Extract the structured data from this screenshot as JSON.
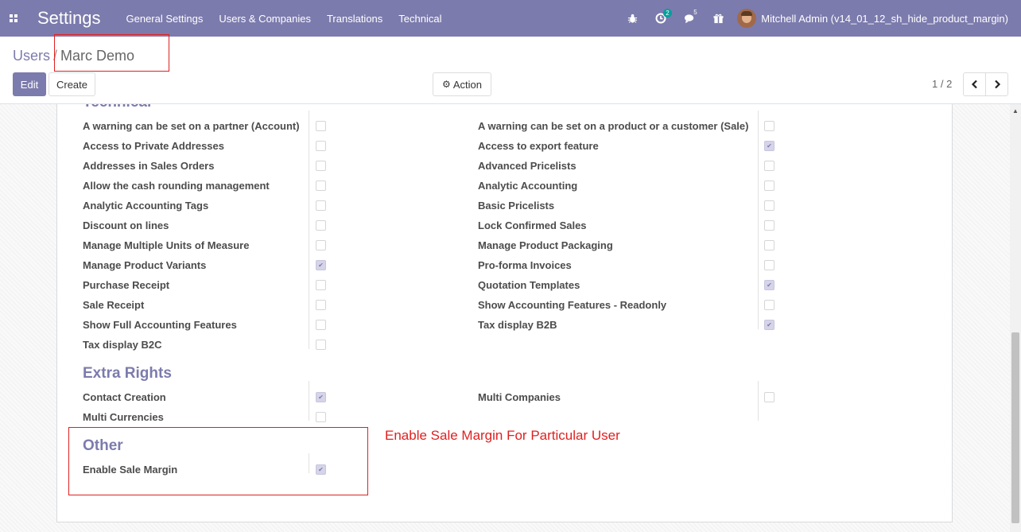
{
  "navbar": {
    "app_title": "Settings",
    "menu": [
      "General Settings",
      "Users & Companies",
      "Translations",
      "Technical"
    ],
    "activity_count": "2",
    "messages_count": "5",
    "user": "Mitchell Admin (v14_01_12_sh_hide_product_margin)"
  },
  "breadcrumb": {
    "parent": "Users",
    "separator": "/",
    "current": "Marc Demo"
  },
  "buttons": {
    "edit": "Edit",
    "create": "Create",
    "action": "Action"
  },
  "pager": {
    "value": "1 / 2"
  },
  "sections": {
    "technical": {
      "title": "Technical",
      "left": [
        {
          "label": "A warning can be set on a partner (Account)",
          "checked": false
        },
        {
          "label": "Access to Private Addresses",
          "checked": false
        },
        {
          "label": "Addresses in Sales Orders",
          "checked": false
        },
        {
          "label": "Allow the cash rounding management",
          "checked": false
        },
        {
          "label": "Analytic Accounting Tags",
          "checked": false
        },
        {
          "label": "Discount on lines",
          "checked": false
        },
        {
          "label": "Manage Multiple Units of Measure",
          "checked": false
        },
        {
          "label": "Manage Product Variants",
          "checked": true
        },
        {
          "label": "Purchase Receipt",
          "checked": false
        },
        {
          "label": "Sale Receipt",
          "checked": false
        },
        {
          "label": "Show Full Accounting Features",
          "checked": false
        },
        {
          "label": "Tax display B2C",
          "checked": false
        }
      ],
      "right": [
        {
          "label": "A warning can be set on a product or a customer (Sale)",
          "checked": false
        },
        {
          "label": "Access to export feature",
          "checked": true
        },
        {
          "label": "Advanced Pricelists",
          "checked": false
        },
        {
          "label": "Analytic Accounting",
          "checked": false
        },
        {
          "label": "Basic Pricelists",
          "checked": false
        },
        {
          "label": "Lock Confirmed Sales",
          "checked": false
        },
        {
          "label": "Manage Product Packaging",
          "checked": false
        },
        {
          "label": "Pro-forma Invoices",
          "checked": false
        },
        {
          "label": "Quotation Templates",
          "checked": true
        },
        {
          "label": "Show Accounting Features - Readonly",
          "checked": false
        },
        {
          "label": "Tax display B2B",
          "checked": true
        }
      ]
    },
    "extra_rights": {
      "title": "Extra Rights",
      "left": [
        {
          "label": "Contact Creation",
          "checked": true
        },
        {
          "label": "Multi Currencies",
          "checked": false
        }
      ],
      "right": [
        {
          "label": "Multi Companies",
          "checked": false
        }
      ]
    },
    "other": {
      "title": "Other",
      "left": [
        {
          "label": "Enable Sale Margin",
          "checked": true
        }
      ]
    }
  },
  "annotation": "Enable Sale Margin For Particular User",
  "colors": {
    "brand": "#7c7bad",
    "highlight": "#e02020"
  }
}
